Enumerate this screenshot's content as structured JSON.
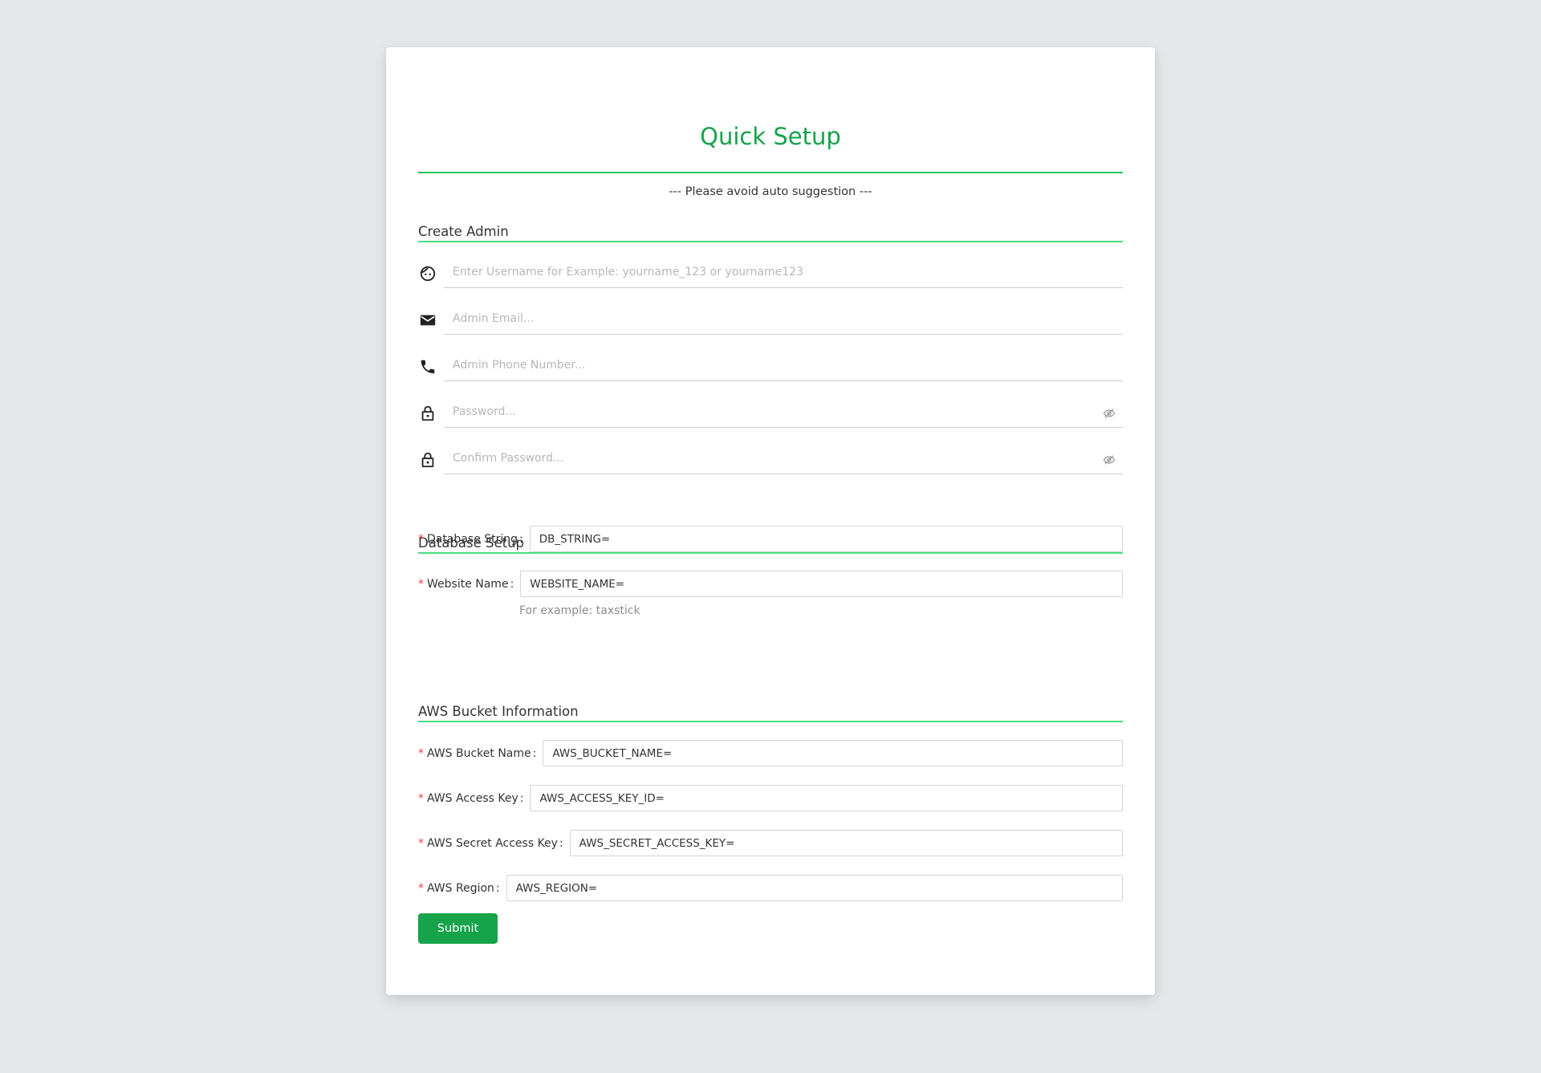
{
  "page": {
    "title": "Quick Setup",
    "hint": "--- Please avoid auto suggestion ---"
  },
  "admin": {
    "section_title": "Create Admin",
    "username_placeholder": "Enter Username for Example: yourname_123 or yourname123",
    "email_placeholder": "Admin Email...",
    "phone_placeholder": "Admin Phone Number...",
    "password_placeholder": "Password...",
    "confirm_password_placeholder": "Confirm Password..."
  },
  "database": {
    "section_title": "Database Setup",
    "db_string_label": "Database String",
    "db_string_value": "DB_STRING=",
    "website_name_label": "Website Name",
    "website_name_value": "WEBSITE_NAME=",
    "website_name_help": "For example: taxstick"
  },
  "aws": {
    "section_title": "AWS Bucket Information",
    "bucket_name_label": "AWS Bucket Name",
    "bucket_name_value": "AWS_BUCKET_NAME=",
    "access_key_label": "AWS Access Key",
    "access_key_value": "AWS_ACCESS_KEY_ID=",
    "secret_key_label": "AWS Secret Access Key",
    "secret_key_value": "AWS_SECRET_ACCESS_KEY=",
    "region_label": "AWS Region",
    "region_value": "AWS_REGION="
  },
  "labels": {
    "required_mark": "*",
    "colon": ":"
  },
  "actions": {
    "submit_label": "Submit"
  },
  "colors": {
    "accent": "#16a34a",
    "divider": "#4ade80",
    "background": "#e5e7eb",
    "required": "#ef4444"
  },
  "icons": [
    "user-face-icon",
    "mail-icon",
    "phone-icon",
    "lock-icon",
    "eye-off-icon"
  ]
}
